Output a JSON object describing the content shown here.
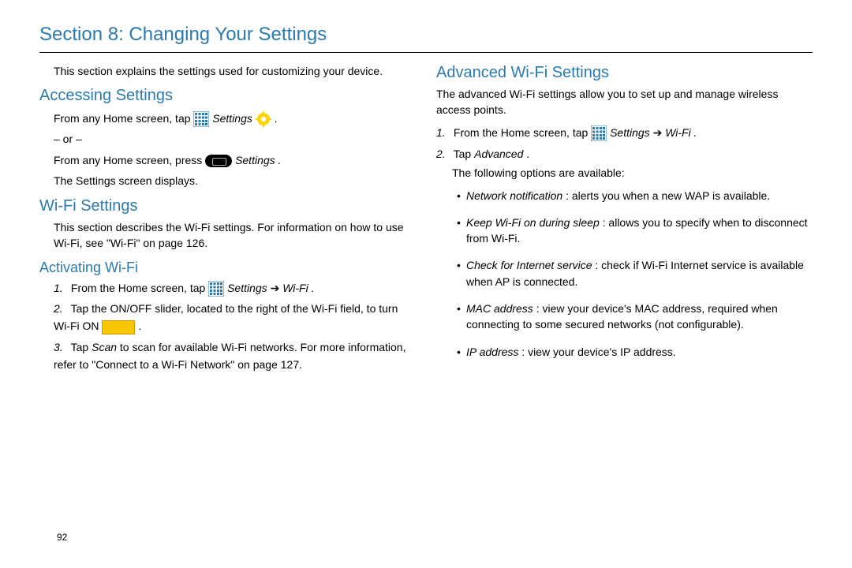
{
  "page": {
    "title": "Section 8: Changing Your Settings",
    "number": "92"
  },
  "left": {
    "intro": "This section explains the settings used for customizing your device.",
    "accessing": {
      "heading": "Accessing Settings",
      "line1a": "From any Home screen, tap ",
      "line1b": " Settings ",
      "or": "– or –",
      "line2a": "From any Home screen, press ",
      "line2b": " Settings .",
      "line3": "The Settings screen displays."
    },
    "wifi": {
      "heading": "Wi-Fi Settings",
      "body_a": "This section describes the Wi-Fi settings. For information on how to use Wi-Fi, see ",
      "body_link": "\"Wi-Fi\"",
      "body_b": " on page 126."
    },
    "activating": {
      "heading": "Activating Wi-Fi",
      "s1_num": "1.",
      "s1a": "From the Home screen, tap ",
      "s1b": " Settings ",
      "s1c": " Wi-Fi .",
      "s2_num": "2.",
      "s2a": "Tap the ON/OFF slider, located to the right of the Wi-Fi field, to turn Wi-Fi ON ",
      "s2b": " .",
      "s3_num": "3.",
      "s3a": "Tap ",
      "s3_scan": "Scan",
      "s3b": " to scan for available Wi-Fi networks. For more information, refer to ",
      "s3_link": "\"Connect to a Wi-Fi Network\"",
      "s3c": " on page 127."
    }
  },
  "right": {
    "heading": "Advanced Wi-Fi Settings",
    "intro": "The advanced Wi-Fi settings allow you to set up and manage wireless access points.",
    "s1_num": "1.",
    "s1a": "From the Home screen, tap ",
    "s1b": " Settings ",
    "s1c": " Wi-Fi .",
    "s2_num": "2.",
    "s2a": "Tap ",
    "s2_adv": "Advanced",
    "s2b": " .",
    "follow": "The following options are available:",
    "bullets": [
      {
        "term": "Network notification",
        "desc": ": alerts you when a new WAP is available."
      },
      {
        "term": "Keep Wi-Fi on during sleep",
        "desc": ": allows you to specify when to disconnect from Wi-Fi."
      },
      {
        "term": "Check for Internet service",
        "desc": ": check if Wi-Fi Internet service is available when AP is connected."
      },
      {
        "term": "MAC address",
        "desc": ": view your device's MAC address, required when connecting to some secured networks (not configurable)."
      },
      {
        "term": "IP address",
        "desc": ": view your device's IP address."
      }
    ]
  }
}
